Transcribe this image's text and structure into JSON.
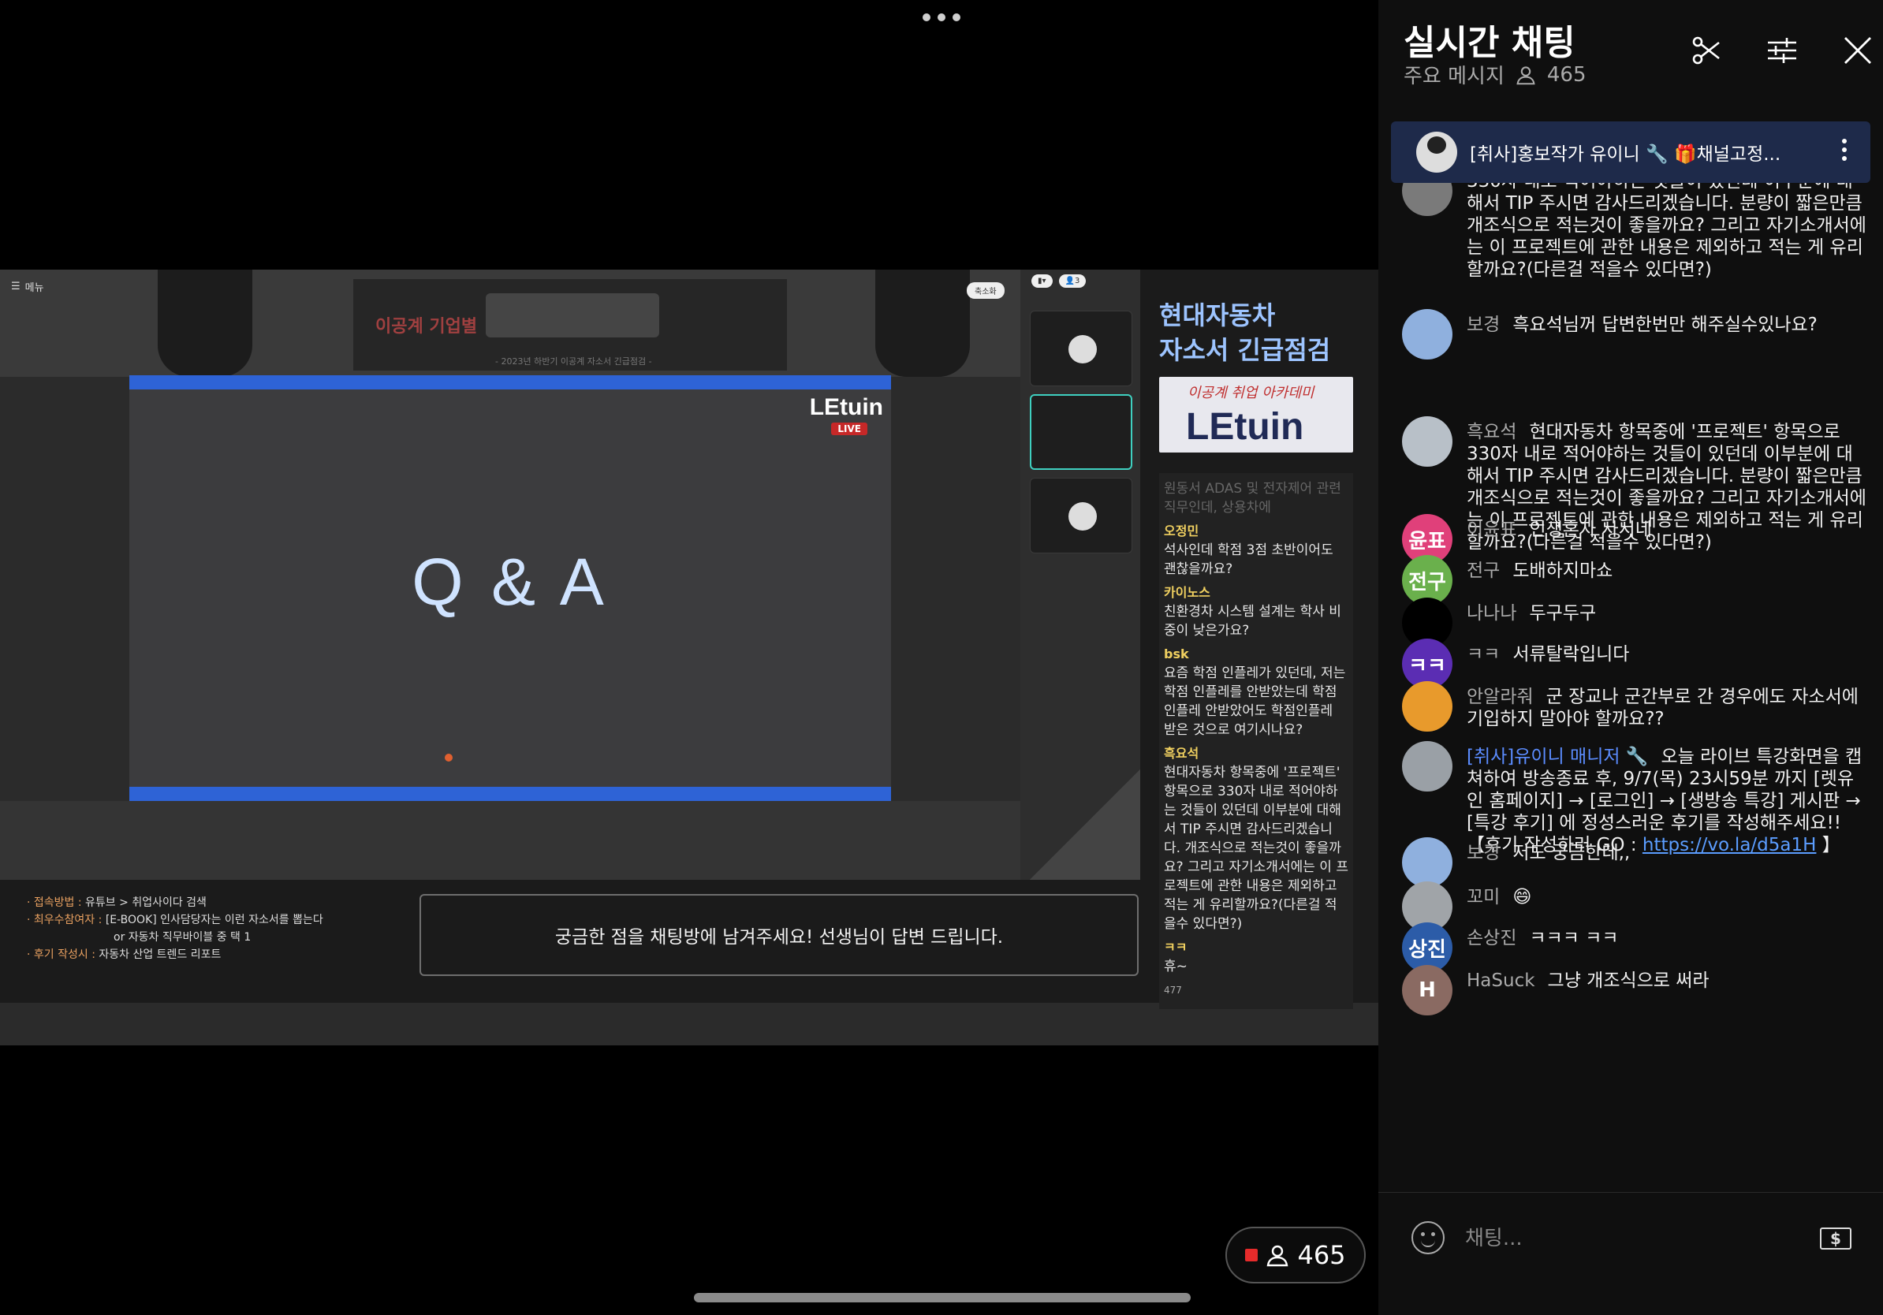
{
  "video": {
    "banner_title": "이공계 기업별",
    "banner_sub": "- 2023년 하반기 이공계 자소서 긴급점검 -",
    "menu_label": "메뉴",
    "shrink_label": "축소화",
    "slide_text": "Q & A",
    "slide_logo": "LEtuin",
    "live_badge": "LIVE",
    "promo_title_1": "현대자동차",
    "promo_title_2": "자소서 긴급점검",
    "promo_logo_sub": "이공계 취업 아카데미",
    "promo_logo_main": "LEtuin",
    "question_box": "궁금한 점을 채팅방에 남겨주세요! 선생님이 답변 드립니다.",
    "notes": [
      {
        "k": "· 접속방법 :",
        "v": "유튜브 > 취업사이다 검색"
      },
      {
        "k": "· 최우수참여자 :",
        "v": "[E-BOOK] 인사담당자는 이런 자소서를 뽑는다"
      },
      {
        "k": "",
        "v": "or 자동차 직무바이블 중 택 1"
      },
      {
        "k": "· 후기 작성시 :",
        "v": "자동차 산업 트렌드 리포트"
      }
    ],
    "mini_chat": [
      {
        "name": "",
        "text": "원동서 ADAS 및 전자제어 관련 직무인데, 상용차에",
        "faded": true
      },
      {
        "name": "오정민",
        "text": "석사인데 학점 3점 초반이어도 괜찮을까요?"
      },
      {
        "name": "카이노스",
        "text": "친환경차 시스템 설계는 학사 비중이 낮은가요?"
      },
      {
        "name": "bsk",
        "text": "요즘 학점 인플레가 있던데, 저는 학점 인플레를 안받았는데 학점인플레 안받았어도 학점인플레 받은 것으로 여기시나요?"
      },
      {
        "name": "흑요석",
        "text": "현대자동차 항목중에 '프로젝트' 항목으로 330자 내로 적어야하는 것들이 있던데 이부분에 대해서 TIP 주시면 감사드리겠습니다. 개조식으로 적는것이 좋을까요? 그리고 자기소개서에는 이 프로젝트에 관한 내용은 제외하고 적는 게 유리할까요?(다른걸 적을수 있다면?)"
      },
      {
        "name": "ㅋㅋ",
        "text": "휴~"
      }
    ],
    "mini_viewers": "477",
    "viewer_count": "465"
  },
  "chat": {
    "title": "실시간 채팅",
    "mode": "주요 메시지",
    "viewer_count": "465",
    "pinned": "[취사]홍보작가 유이니 🔧  🎁채널고정...",
    "input_placeholder": "채팅...",
    "superchat_icon": "$",
    "messages": [
      {
        "author": "",
        "text": "330자 내로 적어야하는 것들이 있던데 이부분에 대해서 TIP 주시면 감사드리겠습니다. 분량이 짧은만큼 개조식으로 적는것이 좋을까요? 그리고 자기소개서에는 이 프로젝트에 관한 내용은 제외하고 적는 게 유리할까요?(다른걸 적을수 있다면?)",
        "avatar": "",
        "avatar_color": "#7a7a7a"
      },
      {
        "author": "보경",
        "text": "흑요석님꺼 답변한번만 해주실수있나요?",
        "avatar": "",
        "avatar_color": "#8fb0de"
      },
      {
        "author": "흑요석",
        "text": "현대자동차 항목중에 '프로젝트' 항목으로 330자 내로 적어야하는 것들이 있던데 이부분에 대해서 TIP 주시면 감사드리겠습니다. 분량이 짧은만큼 개조식으로 적는것이 좋을까요? 그리고 자기소개서에는 이 프로젝트에 관한 내용은 제외하고 적는 게 유리할까요?(다른걸 적을수 있다면?)",
        "avatar": "",
        "avatar_color": "#b8c0c8"
      },
      {
        "author": "이윤표",
        "text": "인생혼자 사시네",
        "avatar": "윤표",
        "avatar_color": "#e0407a"
      },
      {
        "author": "전구",
        "text": "도배하지마쇼",
        "avatar": "전구",
        "avatar_color": "#6ab04c"
      },
      {
        "author": "나나나",
        "text": "두구두구",
        "avatar": "",
        "avatar_color": "#000000"
      },
      {
        "author": "ㅋㅋ",
        "text": "서류탈락입니다",
        "avatar": "ㅋㅋ",
        "avatar_color": "#5b2db3"
      },
      {
        "author": "안알라줘",
        "text": "군 장교나 군간부로 간 경우에도 자소서에 기입하지 말아야 할까요??",
        "avatar": "",
        "avatar_color": "#e89a2c"
      },
      {
        "author": "[취사]유이니 매니저 🔧",
        "text": "오늘 라이브 특강화면을 캡쳐하여 방송종료 후, 9/7(목) 23시59분 까지 [렛유인 홈페이지] → [로그인] → [생방송 특강] 게시판 → [특강 후기] 에 정성스러운 후기를 작성해주세요!! 【후기 작성하러 GO : ",
        "link": "https://vo.la/d5a1H",
        "tail": " 】",
        "avatar": "",
        "avatar_color": "#9aa0a6",
        "manager": true
      },
      {
        "author": "보경",
        "text": "저도 궁금한데,,",
        "avatar": "",
        "avatar_color": "#8fb0de"
      },
      {
        "author": "꼬미",
        "text": "😄",
        "avatar": "",
        "avatar_color": "#a0a4a8"
      },
      {
        "author": "손상진",
        "text": "ㅋㅋㅋ ㅋㅋ",
        "avatar": "상진",
        "avatar_color": "#2c5ca8"
      },
      {
        "author": "HaSuck",
        "text": "그냥 개조식으로 써라",
        "avatar": "H",
        "avatar_color": "#8a6a62"
      }
    ]
  },
  "icons": {
    "clip": "scissors-icon",
    "settings": "sliders-icon",
    "close": "close-icon"
  }
}
